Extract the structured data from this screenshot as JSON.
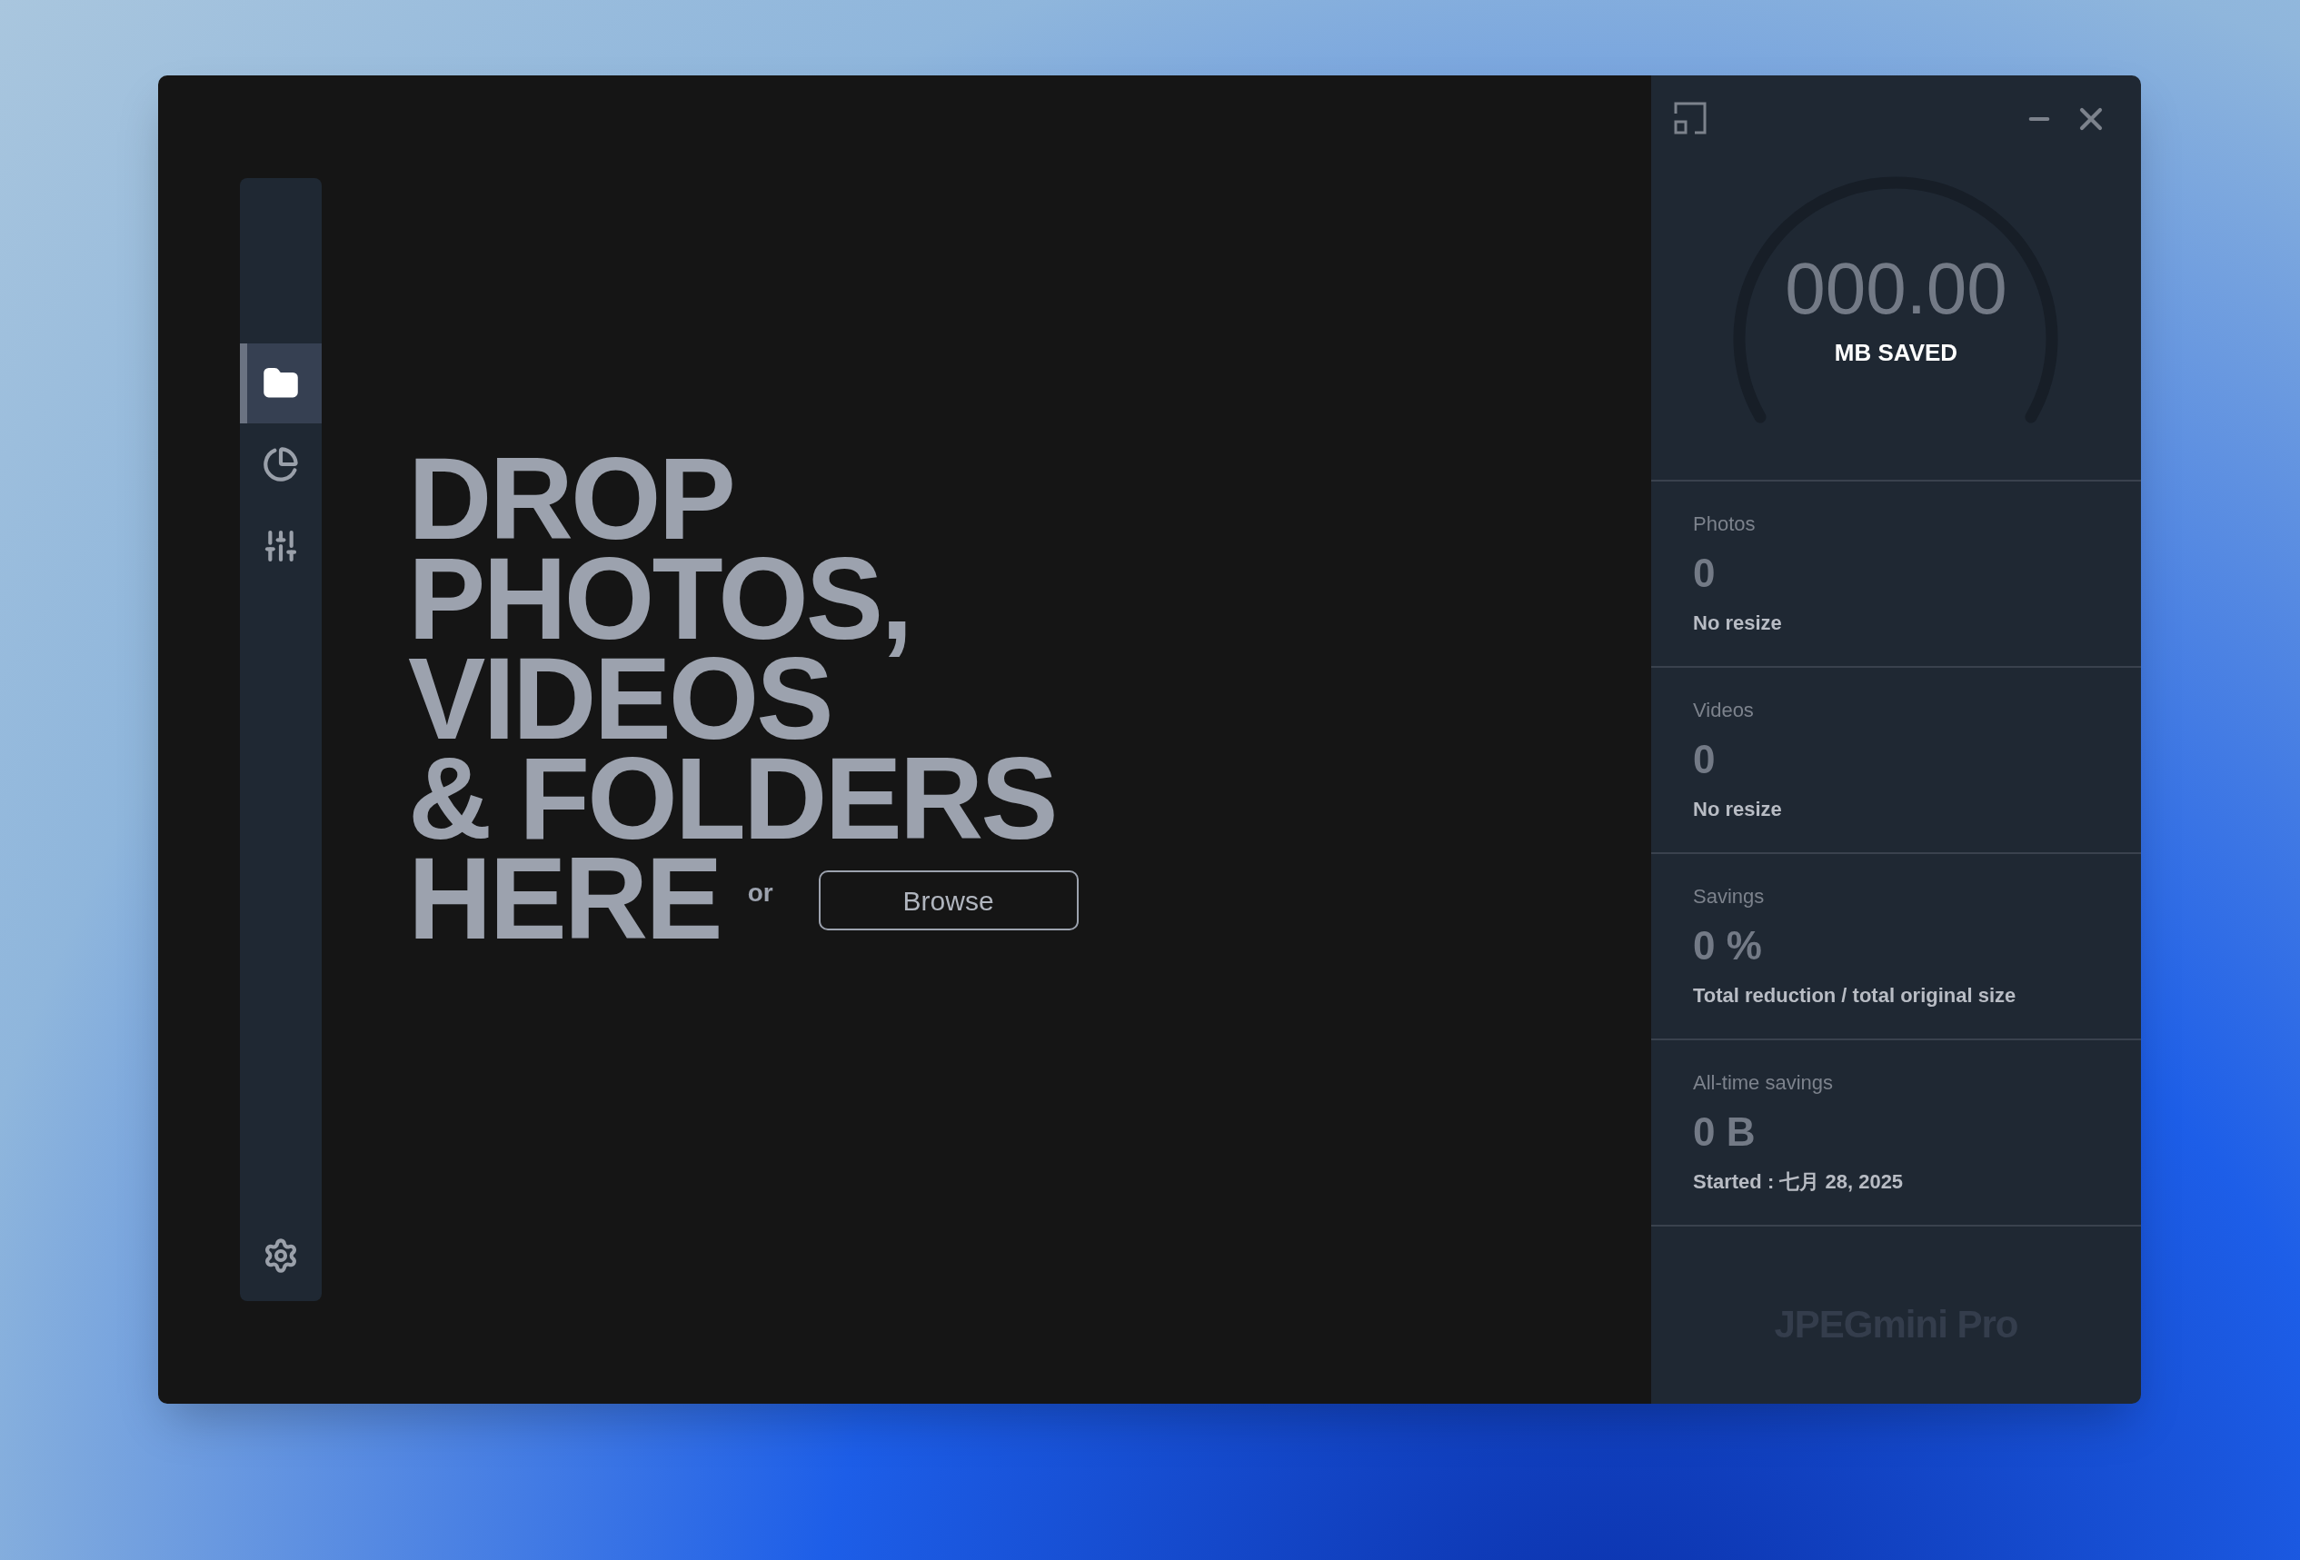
{
  "sidebar": {
    "items": [
      {
        "kind": "folder",
        "selected": true
      },
      {
        "kind": "chart",
        "selected": false
      },
      {
        "kind": "sliders",
        "selected": false
      }
    ],
    "settings": {
      "kind": "gear"
    }
  },
  "drop_zone": {
    "headline": [
      "DROP",
      "PHOTOS,",
      "VIDEOS",
      "& FOLDERS",
      "HERE"
    ],
    "or": "or",
    "browse": "Browse"
  },
  "gauge": {
    "value": "000.00",
    "unit": "MB SAVED"
  },
  "stats": [
    {
      "label": "Photos",
      "value": "0",
      "note": "No resize"
    },
    {
      "label": "Videos",
      "value": "0",
      "note": "No resize"
    },
    {
      "label": "Savings",
      "value": "0 %",
      "note": "Total reduction / total original size"
    },
    {
      "label": "All-time savings",
      "value": "0 B",
      "note": "Started : 七月 28, 2025"
    }
  ],
  "logo": "JPEGmini Pro"
}
